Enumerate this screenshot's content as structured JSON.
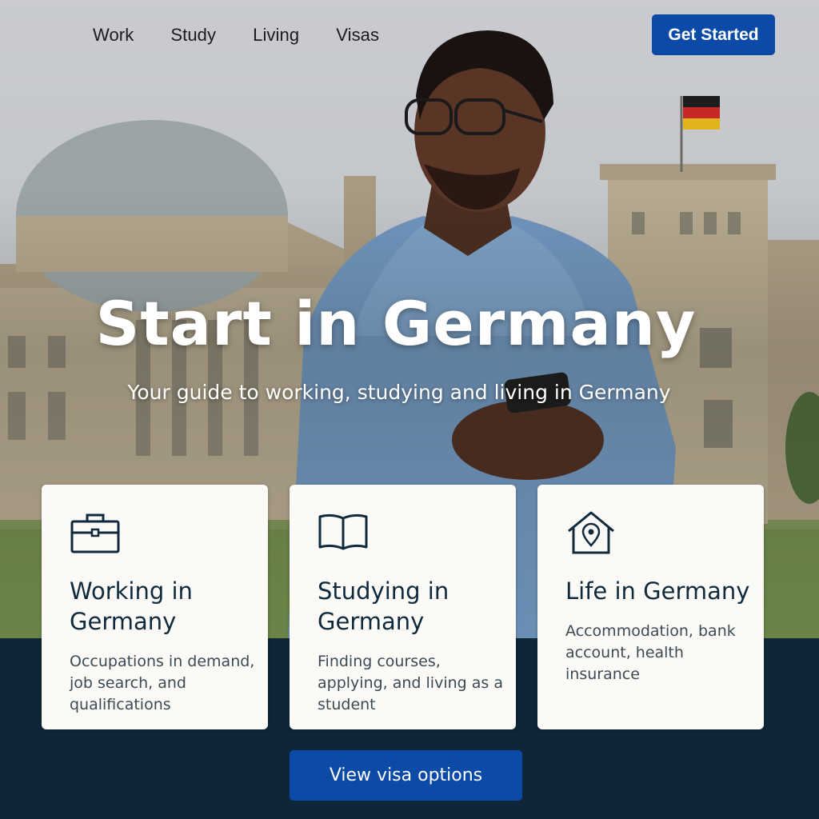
{
  "nav": {
    "links": [
      "Work",
      "Study",
      "Living",
      "Visas"
    ],
    "cta_label": "Get Started"
  },
  "hero": {
    "title": "Start in Germany",
    "subtitle": "Your guide to working, studying and living in Germany"
  },
  "cards": [
    {
      "icon": "briefcase-icon",
      "title": "Working in Germany",
      "description": "Occupations in demand, job search, and qualifications"
    },
    {
      "icon": "open-book-icon",
      "title": "Studying in Germany",
      "description": "Finding courses, applying, and living as a student"
    },
    {
      "icon": "house-location-icon",
      "title": "Life in Germany",
      "description": "Accommodation, bank account, health insurance"
    }
  ],
  "cta": {
    "label": "View visa options"
  },
  "colors": {
    "primary_button": "#0b4aa6",
    "footer_band": "#0e2638",
    "card_bg": "#fbfaf7",
    "card_title": "#0f2a3d"
  }
}
